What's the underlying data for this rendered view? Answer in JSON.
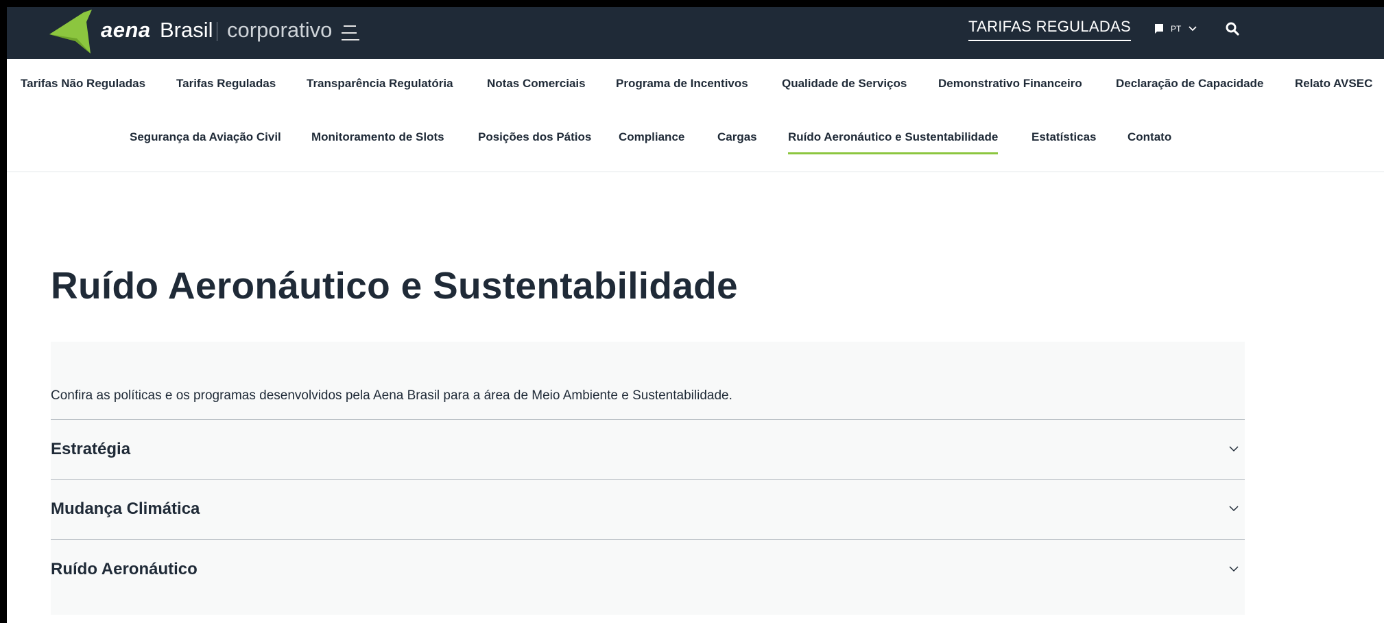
{
  "brand": {
    "aena": "aena",
    "brasil": "Brasil",
    "corporativo": "corporativo",
    "accent_color": "#8cc63f",
    "header_bg": "#1f2a37"
  },
  "header": {
    "tarifas_link": "TARIFAS REGULADAS",
    "lang_code": "PT",
    "icons": [
      "menu-icon",
      "flag-icon",
      "chevron-down-icon",
      "search-icon"
    ]
  },
  "nav": {
    "row1": [
      "Tarifas Não Reguladas",
      "Tarifas Reguladas",
      "Transparência Regulatória",
      "Notas Comerciais",
      "Programa de Incentivos",
      "Qualidade de Serviços",
      "Demonstrativo Financeiro",
      "Declaração de Capacidade",
      "Relato AVSEC"
    ],
    "row2": [
      "Segurança da Aviação Civil",
      "Monitoramento de Slots",
      "Posições dos Pátios",
      "Compliance",
      "Cargas",
      "Ruído Aeronáutico e Sustentabilidade",
      "Estatísticas",
      "Contato"
    ],
    "active": "Ruído Aeronáutico e Sustentabilidade"
  },
  "main": {
    "title": "Ruído Aeronáutico e Sustentabilidade",
    "intro": "Confira as políticas e os programas desenvolvidos pela Aena Brasil para a área de Meio Ambiente e Sustentabilidade.",
    "accordion": [
      {
        "label": "Estratégia"
      },
      {
        "label": "Mudança Climática"
      },
      {
        "label": "Ruído Aeronáutico"
      }
    ]
  }
}
